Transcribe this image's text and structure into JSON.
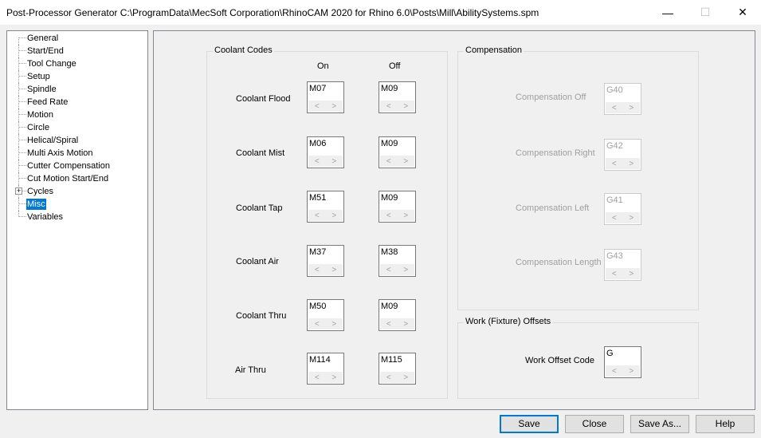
{
  "window": {
    "title": "Post-Processor Generator   C:\\ProgramData\\MecSoft Corporation\\RhinoCAM 2020 for Rhino 6.0\\Posts\\Mill\\AbilitySystems.spm",
    "minimize": "—",
    "maximize": "☐",
    "close": "✕"
  },
  "tree": {
    "items": [
      {
        "label": "General"
      },
      {
        "label": "Start/End"
      },
      {
        "label": "Tool Change"
      },
      {
        "label": "Setup"
      },
      {
        "label": "Spindle"
      },
      {
        "label": "Feed Rate"
      },
      {
        "label": "Motion"
      },
      {
        "label": "Circle"
      },
      {
        "label": "Helical/Spiral"
      },
      {
        "label": "Multi Axis Motion"
      },
      {
        "label": "Cutter Compensation"
      },
      {
        "label": "Cut Motion Start/End"
      },
      {
        "label": "Cycles",
        "expander": "+"
      },
      {
        "label": "Misc",
        "selected": true
      },
      {
        "label": "Variables"
      }
    ]
  },
  "coolant": {
    "group_label": "Coolant Codes",
    "col_on": "On",
    "col_off": "Off",
    "rows": [
      {
        "label": "Coolant Flood",
        "on": "M07",
        "off": "M09"
      },
      {
        "label": "Coolant Mist",
        "on": "M06",
        "off": "M09"
      },
      {
        "label": "Coolant Tap",
        "on": "M51",
        "off": "M09"
      },
      {
        "label": "Coolant Air",
        "on": "M37",
        "off": "M38"
      },
      {
        "label": "Coolant Thru",
        "on": "M50",
        "off": "M09"
      },
      {
        "label": "Air Thru",
        "on": "M114",
        "off": "M115"
      }
    ]
  },
  "compensation": {
    "group_label": "Compensation",
    "rows": [
      {
        "label": "Compensation Off",
        "value": "G40"
      },
      {
        "label": "Compensation Right",
        "value": "G42"
      },
      {
        "label": "Compensation Left",
        "value": "G41"
      },
      {
        "label": "Compensation Length",
        "value": "G43"
      }
    ]
  },
  "work_offsets": {
    "group_label": "Work (Fixture) Offsets",
    "label": "Work Offset Code",
    "value": "G"
  },
  "spin_arrows": {
    "left": "<",
    "right": ">"
  },
  "buttons": {
    "save": "Save",
    "close": "Close",
    "save_as": "Save As...",
    "help": "Help"
  }
}
